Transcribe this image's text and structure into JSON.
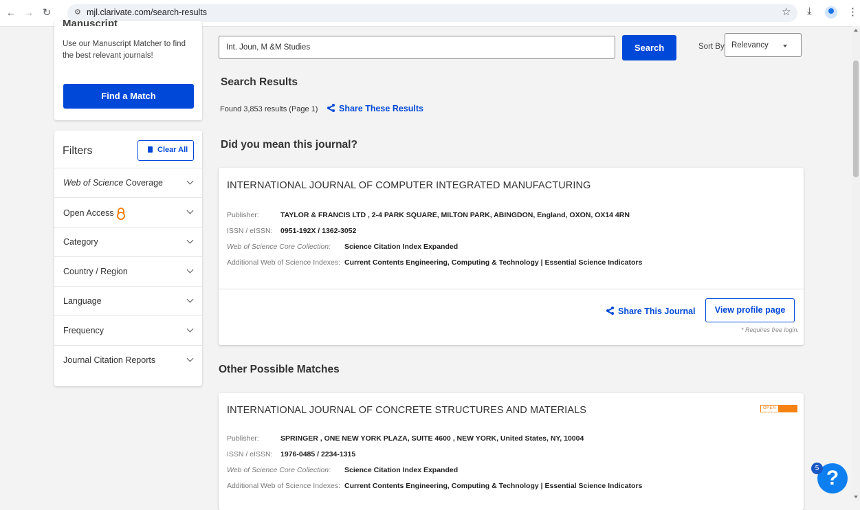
{
  "browser": {
    "url": "mjl.clarivate.com/search-results"
  },
  "manuscript_matcher": {
    "heading": "Manuscript",
    "text": "Use our Manuscript Matcher to find the best relevant journals!",
    "button": "Find a Match"
  },
  "filters": {
    "title": "Filters",
    "clear_all": "Clear All",
    "items": [
      {
        "label": "Web of Science Coverage"
      },
      {
        "label": "Open Access"
      },
      {
        "label": "Category"
      },
      {
        "label": "Country / Region"
      },
      {
        "label": "Language"
      },
      {
        "label": "Frequency"
      },
      {
        "label": "Journal Citation Reports"
      }
    ]
  },
  "search": {
    "value": "Int. Joun, M &M Studies",
    "button": "Search",
    "sort_label": "Sort By:",
    "sort_value": "Relevancy"
  },
  "results": {
    "heading": "Search Results",
    "found": "Found 3,853 results (Page 1)",
    "share": "Share These Results",
    "did_you_mean": "Did you mean this journal?",
    "other_heading": "Other Possible Matches"
  },
  "journal1": {
    "title": "INTERNATIONAL JOURNAL OF COMPUTER INTEGRATED MANUFACTURING",
    "publisher_label": "Publisher:",
    "publisher": "TAYLOR & FRANCIS LTD , 2-4 PARK SQUARE, MILTON PARK, ABINGDON, England, OXON, OX14 4RN",
    "issn_label": "ISSN / eISSN:",
    "issn": "0951-192X / 1362-3052",
    "core_label": "Web of Science Core Collection:",
    "core": "Science Citation Index Expanded",
    "additional_label": "Additional Web of Science Indexes:",
    "additional": "Current Contents Engineering, Computing & Technology | Essential Science Indicators",
    "share": "Share This Journal",
    "view_profile": "View profile page",
    "requires_login": "* Requires free login."
  },
  "journal2": {
    "title": "INTERNATIONAL JOURNAL OF CONCRETE STRUCTURES AND MATERIALS",
    "oa_badge_open": "OPEN",
    "oa_badge_access": "ACCESS",
    "publisher_label": "Publisher:",
    "publisher": "SPRINGER , ONE NEW YORK PLAZA, SUITE 4600 , NEW YORK, United States, NY, 10004",
    "issn_label": "ISSN / eISSN:",
    "issn": "1976-0485 / 2234-1315",
    "core_label": "Web of Science Core Collection:",
    "core": "Science Citation Index Expanded",
    "additional_label": "Additional Web of Science Indexes:",
    "additional": "Current Contents Engineering, Computing & Technology | Essential Science Indicators"
  },
  "help": {
    "badge": "5",
    "icon": "?"
  },
  "colors": {
    "primary": "#0049d8",
    "open_access": "#f68212",
    "page_bg": "#f3f3f3"
  }
}
